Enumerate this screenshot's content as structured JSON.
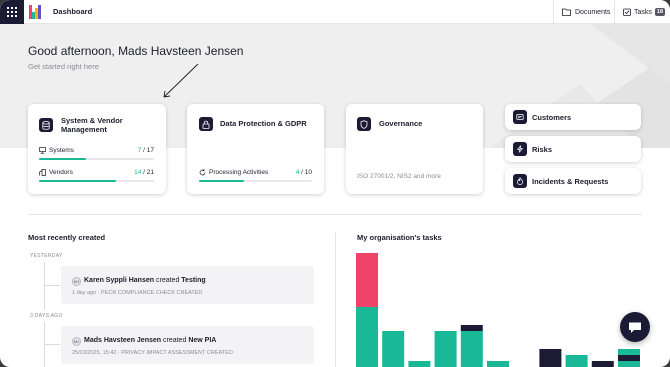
{
  "header": {
    "breadcrumb": "Dashboard",
    "documents_label": "Documents",
    "tasks_label": "Tasks",
    "tasks_count": "18"
  },
  "hero": {
    "greeting": "Good afternoon, Mads Havsteen Jensen",
    "subtitle": "Get started right here"
  },
  "cards": {
    "system_vendor": {
      "title_line1": "System & Vendor",
      "title_line2": "Management",
      "systems_label": "Systems",
      "systems_done": "7",
      "systems_total": "/ 17",
      "systems_progress": 0.41,
      "vendors_label": "Vendors",
      "vendors_done": "14",
      "vendors_total": "/ 21",
      "vendors_progress": 0.67
    },
    "data_protection": {
      "title": "Data Protection & GDPR",
      "activities_label": "Processing Activities",
      "activities_done": "4",
      "activities_total": "/ 10",
      "activities_progress": 0.4
    },
    "governance": {
      "title": "Governance",
      "frameworks": "ISO 27001/2, NIS2 and more"
    }
  },
  "quick_links": [
    {
      "label": "Customers",
      "icon": "customers-icon"
    },
    {
      "label": "Risks",
      "icon": "risks-icon"
    },
    {
      "label": "Incidents & Requests",
      "icon": "incidents-icon"
    }
  ],
  "recent": {
    "title": "Most recently created",
    "groups": [
      {
        "day": "YESTERDAY",
        "initials": "KH",
        "user": "Karen Syppli Hansen",
        "verb": "created",
        "item": "Testing",
        "meta": "1 day ago · PECR COMPLIANCE CHECK CREATED"
      },
      {
        "day": "3 DAYS AGO",
        "initials": "MJ",
        "user": "Mads Havsteen Jensen",
        "verb": "created",
        "item": "New PIA",
        "meta": "25/03/2025, 15:42 · PRIVACY IMPACT ASSESSMENT CREATED"
      }
    ]
  },
  "tasks_chart": {
    "title": "My organisation's tasks"
  },
  "chart_data": {
    "type": "bar",
    "stacked": true,
    "visible_portion_only": true,
    "series": [
      {
        "color": "#19b897",
        "values": [
          60,
          36,
          6,
          36,
          36,
          6,
          0,
          0,
          12,
          0,
          6
        ]
      },
      {
        "color": "#f0436a",
        "values": [
          54,
          0,
          0,
          0,
          0,
          0,
          0,
          0,
          0,
          0,
          0
        ]
      },
      {
        "color": "#1c1b36",
        "values": [
          0,
          0,
          0,
          0,
          6,
          0,
          0,
          18,
          0,
          6,
          6
        ]
      },
      {
        "color": "#19b897",
        "values": [
          0,
          0,
          0,
          0,
          0,
          0,
          0,
          0,
          0,
          0,
          6
        ]
      }
    ]
  },
  "colors": {
    "navy": "#1c1b36",
    "teal": "#19b897",
    "red": "#f0436a"
  }
}
